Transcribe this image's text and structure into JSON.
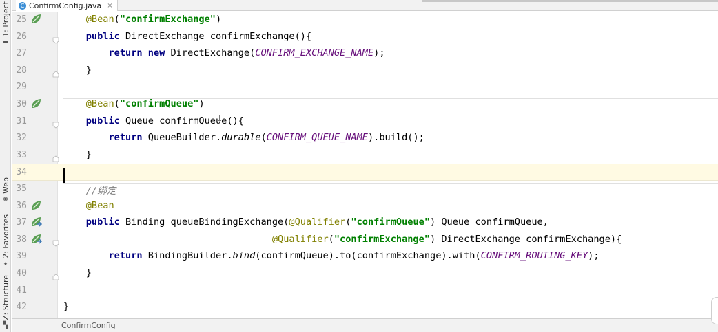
{
  "tool_window_tabs": [
    {
      "label": "1: Project",
      "icon": "folder-icon"
    },
    {
      "label": "Web",
      "icon": "web-icon"
    },
    {
      "label": "2: Favorites",
      "icon": "star-icon"
    },
    {
      "label": "Z: Structure",
      "icon": "structure-icon"
    }
  ],
  "editor_tab": {
    "icon_letter": "C",
    "filename": "ConfirmConfig.java",
    "close": "×"
  },
  "breadcrumb": "ConfirmConfig",
  "caret_line": 34,
  "colors": {
    "keyword": "#000080",
    "annotation": "#808000",
    "string": "#008000",
    "constant": "#660e7a",
    "comment": "#808080",
    "line_number": "#999999",
    "caret_line_bg": "#fffae3",
    "bean_icon": "#5a9e54"
  },
  "lines": [
    {
      "num": "25",
      "gutter_icon": "bean-icon",
      "fold": "",
      "tokens": [
        [
          "    ",
          ""
        ],
        [
          "@Bean",
          "ann"
        ],
        [
          "(",
          ""
        ],
        [
          "\"confirmExchange\"",
          "str"
        ],
        [
          ")",
          ""
        ]
      ]
    },
    {
      "num": "26",
      "gutter_icon": "",
      "fold": "open",
      "tokens": [
        [
          "    ",
          ""
        ],
        [
          "public",
          "kw"
        ],
        [
          " DirectExchange confirmExchange(){",
          ""
        ]
      ]
    },
    {
      "num": "27",
      "gutter_icon": "",
      "fold": "",
      "tokens": [
        [
          "        ",
          ""
        ],
        [
          "return",
          "kw"
        ],
        [
          " ",
          ""
        ],
        [
          "new",
          "kw"
        ],
        [
          " DirectExchange(",
          ""
        ],
        [
          "CONFIRM_EXCHANGE_NAME",
          "cst"
        ],
        [
          ");",
          ""
        ]
      ]
    },
    {
      "num": "28",
      "gutter_icon": "",
      "fold": "close",
      "tokens": [
        [
          "    }",
          ""
        ]
      ]
    },
    {
      "num": "29",
      "gutter_icon": "",
      "fold": "",
      "tokens": []
    },
    {
      "num": "30",
      "gutter_icon": "bean-icon",
      "fold": "",
      "tokens": [
        [
          "    ",
          ""
        ],
        [
          "@Bean",
          "ann"
        ],
        [
          "(",
          ""
        ],
        [
          "\"confirmQueue\"",
          "str"
        ],
        [
          ")",
          ""
        ]
      ]
    },
    {
      "num": "31",
      "gutter_icon": "",
      "fold": "open",
      "tokens": [
        [
          "    ",
          ""
        ],
        [
          "public",
          "kw"
        ],
        [
          " Queue confirmQueue(){",
          ""
        ]
      ]
    },
    {
      "num": "32",
      "gutter_icon": "",
      "fold": "",
      "tokens": [
        [
          "        ",
          ""
        ],
        [
          "return",
          "kw"
        ],
        [
          " QueueBuilder.",
          ""
        ],
        [
          "durable",
          "stat"
        ],
        [
          "(",
          ""
        ],
        [
          "CONFIRM_QUEUE_NAME",
          "cst"
        ],
        [
          ").build();",
          ""
        ]
      ]
    },
    {
      "num": "33",
      "gutter_icon": "",
      "fold": "close",
      "tokens": [
        [
          "    }",
          ""
        ]
      ]
    },
    {
      "num": "34",
      "gutter_icon": "",
      "fold": "",
      "tokens": []
    },
    {
      "num": "35",
      "gutter_icon": "",
      "fold": "",
      "tokens": [
        [
          "    ",
          ""
        ],
        [
          "//绑定",
          "cmt"
        ]
      ]
    },
    {
      "num": "36",
      "gutter_icon": "bean-icon",
      "fold": "",
      "tokens": [
        [
          "    ",
          ""
        ],
        [
          "@Bean",
          "ann"
        ]
      ]
    },
    {
      "num": "37",
      "gutter_icon": "bean-link-icon",
      "fold": "",
      "tokens": [
        [
          "    ",
          ""
        ],
        [
          "public",
          "kw"
        ],
        [
          " Binding queueBindingExchange(",
          ""
        ],
        [
          "@Qualifier",
          "ann"
        ],
        [
          "(",
          ""
        ],
        [
          "\"confirmQueue\"",
          "str"
        ],
        [
          ") Queue confirmQueue,",
          ""
        ]
      ]
    },
    {
      "num": "38",
      "gutter_icon": "bean-link-icon",
      "fold": "open",
      "tokens": [
        [
          "                                     ",
          ""
        ],
        [
          "@Qualifier",
          "ann"
        ],
        [
          "(",
          ""
        ],
        [
          "\"confirmExchange\"",
          "str"
        ],
        [
          ") DirectExchange confirmExchange){",
          ""
        ]
      ]
    },
    {
      "num": "39",
      "gutter_icon": "",
      "fold": "",
      "tokens": [
        [
          "        ",
          ""
        ],
        [
          "return",
          "kw"
        ],
        [
          " BindingBuilder.",
          ""
        ],
        [
          "bind",
          "stat"
        ],
        [
          "(confirmQueue).to(confirmExchange).with(",
          ""
        ],
        [
          "CONFIRM_ROUTING_KEY",
          "cst"
        ],
        [
          ");",
          ""
        ]
      ]
    },
    {
      "num": "40",
      "gutter_icon": "",
      "fold": "close",
      "tokens": [
        [
          "    }",
          ""
        ]
      ]
    },
    {
      "num": "41",
      "gutter_icon": "",
      "fold": "",
      "tokens": []
    },
    {
      "num": "42",
      "gutter_icon": "",
      "fold": "",
      "tokens": [
        [
          "}",
          ""
        ]
      ]
    }
  ]
}
